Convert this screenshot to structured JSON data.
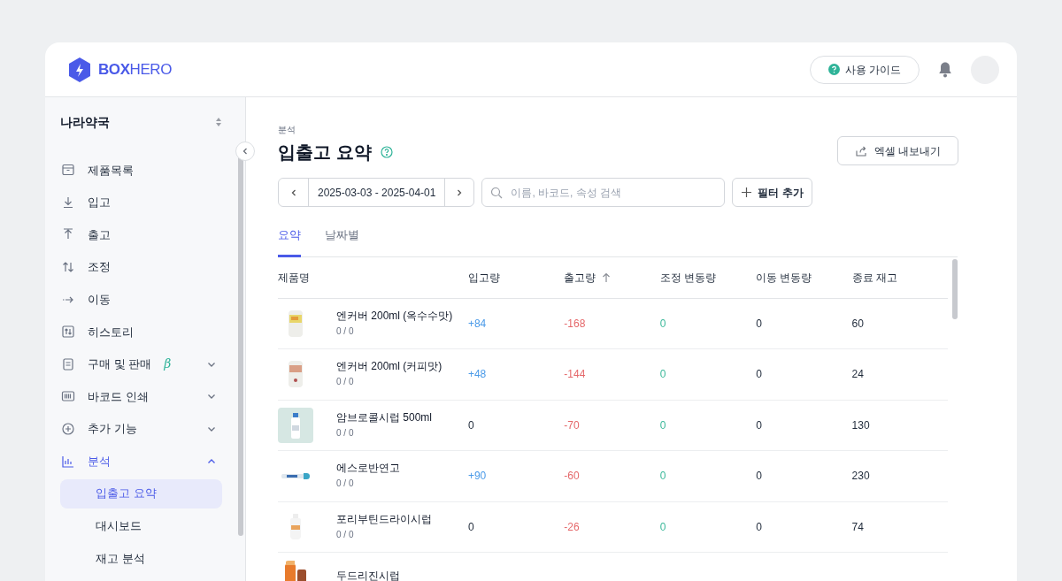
{
  "header": {
    "logo": {
      "bold": "BOX",
      "light": "HERO"
    },
    "guide_button": "사용 가이드"
  },
  "sidebar": {
    "company": "나라약국",
    "items": [
      {
        "label": "제품목록",
        "selected": false
      },
      {
        "label": "입고",
        "selected": false
      },
      {
        "label": "출고",
        "selected": false
      },
      {
        "label": "조정",
        "selected": false
      },
      {
        "label": "이동",
        "selected": false
      },
      {
        "label": "히스토리",
        "selected": false
      },
      {
        "label": "구매 및 판매",
        "badge": "β",
        "selected": false,
        "expanded": false
      },
      {
        "label": "바코드 인쇄",
        "selected": false,
        "expanded": false
      },
      {
        "label": "추가 기능",
        "selected": false,
        "expanded": false
      },
      {
        "label": "분석",
        "selected": true,
        "expanded": true,
        "children": [
          {
            "label": "입출고 요약",
            "selected": true
          },
          {
            "label": "대시보드",
            "selected": false
          },
          {
            "label": "재고 분석",
            "selected": false
          }
        ]
      }
    ]
  },
  "page": {
    "breadcrumb": "분석",
    "title": "입출고 요약",
    "export_button": "엑셀 내보내기",
    "date_range": "2025-03-03 - 2025-04-01",
    "search": {
      "placeholder": "이름, 바코드, 속성 검색"
    },
    "filter_button": "필터 추가",
    "tabs": [
      {
        "label": "요약",
        "selected": true
      },
      {
        "label": "날짜별",
        "selected": false
      }
    ]
  },
  "table": {
    "columns": [
      {
        "label": "제품명"
      },
      {
        "label": "입고량"
      },
      {
        "label": "출고량",
        "sorted_ascending": true
      },
      {
        "label": "조정 변동량"
      },
      {
        "label": "이동 변동량"
      },
      {
        "label": "종료 재고"
      }
    ],
    "rows": [
      {
        "name": "엔커버 200ml (옥수수맛)",
        "sub": "0 / 0",
        "in": "+84",
        "out": "-168",
        "adjust": "0",
        "move": "0",
        "stock": "60"
      },
      {
        "name": "엔커버 200ml (커피맛)",
        "sub": "0 / 0",
        "in": "+48",
        "out": "-144",
        "adjust": "0",
        "move": "0",
        "stock": "24"
      },
      {
        "name": "암브로콜시럽 500ml",
        "sub": "0 / 0",
        "in": "0",
        "out": "-70",
        "adjust": "0",
        "move": "0",
        "stock": "130"
      },
      {
        "name": "에스로반연고",
        "sub": "0 / 0",
        "in": "+90",
        "out": "-60",
        "adjust": "0",
        "move": "0",
        "stock": "230"
      },
      {
        "name": "포리부틴드라이시럽",
        "sub": "0 / 0",
        "in": "0",
        "out": "-26",
        "adjust": "0",
        "move": "0",
        "stock": "74"
      },
      {
        "name": "두드리진시럽"
      }
    ]
  }
}
